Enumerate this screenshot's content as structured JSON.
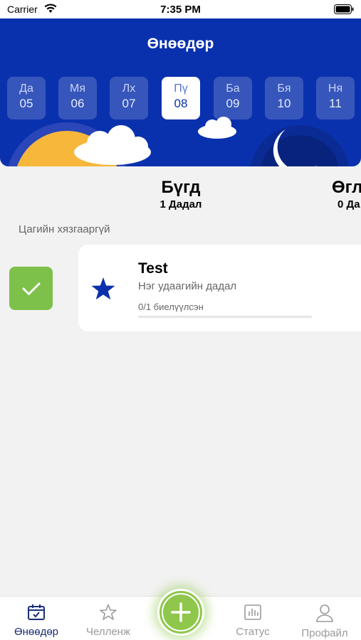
{
  "status_bar": {
    "carrier": "Carrier",
    "time": "7:35 PM"
  },
  "header": {
    "title": "Өнөөдөр",
    "background_color": "#0a31ad",
    "days": [
      {
        "name": "Да",
        "num": "05"
      },
      {
        "name": "Мя",
        "num": "06"
      },
      {
        "name": "Лх",
        "num": "07"
      },
      {
        "name": "Пү",
        "num": "08",
        "selected": true
      },
      {
        "name": "Ба",
        "num": "09"
      },
      {
        "name": "Бя",
        "num": "10"
      },
      {
        "name": "Ня",
        "num": "11"
      }
    ]
  },
  "summary": {
    "all_title": "Бүгд",
    "all_count": "1 Дадал",
    "morning_title": "Өгл",
    "morning_count": "0 Да"
  },
  "section": {
    "label": "Цагийн хязгааргүй"
  },
  "habit": {
    "title": "Test",
    "subtitle": "Нэг удаагийн дадал",
    "progress_text": "0/1 биелүүлсэн",
    "progress_fraction": 0,
    "check_color": "#7dc14a",
    "icon": "star-icon"
  },
  "tabbar": {
    "today": "Өнөөдөр",
    "challenge": "Челленж",
    "status": "Статус",
    "profile": "Профайл",
    "accent_color": "#8ec74b"
  }
}
